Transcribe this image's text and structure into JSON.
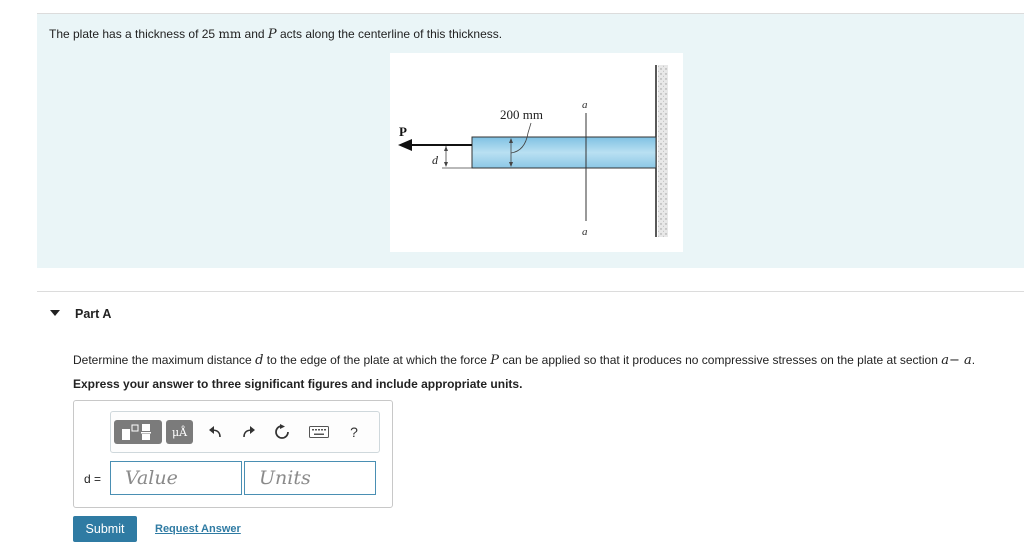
{
  "problem": {
    "text_before": "The plate has a thickness of 25 ",
    "thickness_unit": "mm",
    "text_mid": " and ",
    "force_symbol": "P",
    "text_after": " acts along the centerline of this thickness."
  },
  "figure": {
    "force_label": "P",
    "distance_label": "d",
    "dimension_label": "200 mm",
    "section_label_top": "a",
    "section_label_bottom": "a"
  },
  "part": {
    "title": "Part A",
    "question_before": "Determine the maximum distance ",
    "question_var_d": "d",
    "question_mid": " to the edge of the plate at which the force ",
    "question_var_p": "P",
    "question_after": " can be applied so that it produces no compressive stresses on the plate at section ",
    "question_section": "a− a",
    "question_end": ".",
    "instruction": "Express your answer to three significant figures and include appropriate units."
  },
  "answer": {
    "variable_label": "d =",
    "value_placeholder": "Value",
    "units_placeholder": "Units",
    "units_button_label": "μÅ",
    "help_label": "?"
  },
  "actions": {
    "submit_label": "Submit",
    "request_answer_label": "Request Answer"
  },
  "colors": {
    "panel_bg": "#eaf5f7",
    "plate_fill": "#a6d4ea",
    "submit_bg": "#2f7ba3",
    "input_border": "#4a8fb3"
  },
  "icons": {
    "template": "template-icon",
    "undo": "undo-icon",
    "redo": "redo-icon",
    "reset": "reset-icon",
    "keyboard": "keyboard-icon",
    "help": "help-icon"
  }
}
